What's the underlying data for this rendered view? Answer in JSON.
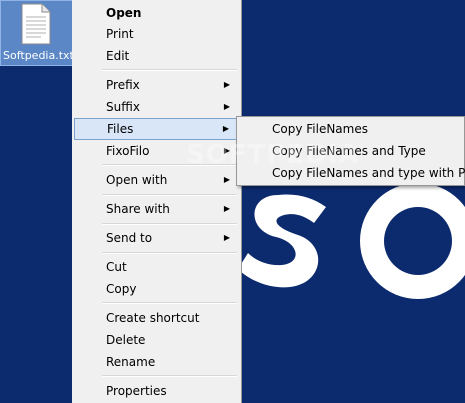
{
  "desktop": {
    "file_name": "Softpedia.txt",
    "file_icon": "text-file-icon",
    "background_logo": "so",
    "colors": {
      "background": "#0c2a6e",
      "logo": "#ffffff",
      "icon_selection": "#5b87c6"
    }
  },
  "context_menu": {
    "items": [
      {
        "label": "Open",
        "bold": true
      },
      {
        "label": "Print"
      },
      {
        "label": "Edit"
      },
      {
        "label": "Prefix",
        "submenu": true
      },
      {
        "label": "Suffix",
        "submenu": true
      },
      {
        "label": "Files",
        "submenu": true,
        "highlighted": true
      },
      {
        "label": "FixoFilo",
        "submenu": true
      },
      {
        "label": "Open with",
        "submenu": true
      },
      {
        "label": "Share with",
        "submenu": true
      },
      {
        "label": "Send to",
        "submenu": true
      },
      {
        "label": "Cut"
      },
      {
        "label": "Copy"
      },
      {
        "label": "Create shortcut"
      },
      {
        "label": "Delete"
      },
      {
        "label": "Rename"
      },
      {
        "label": "Properties"
      }
    ],
    "submenu_arrow": "▶"
  },
  "files_submenu": {
    "items": [
      {
        "label": "Copy FileNames"
      },
      {
        "label": "Copy FileNames and Type"
      },
      {
        "label": "Copy FileNames and type with Path"
      }
    ]
  },
  "watermark": "SOFTPEDIA"
}
